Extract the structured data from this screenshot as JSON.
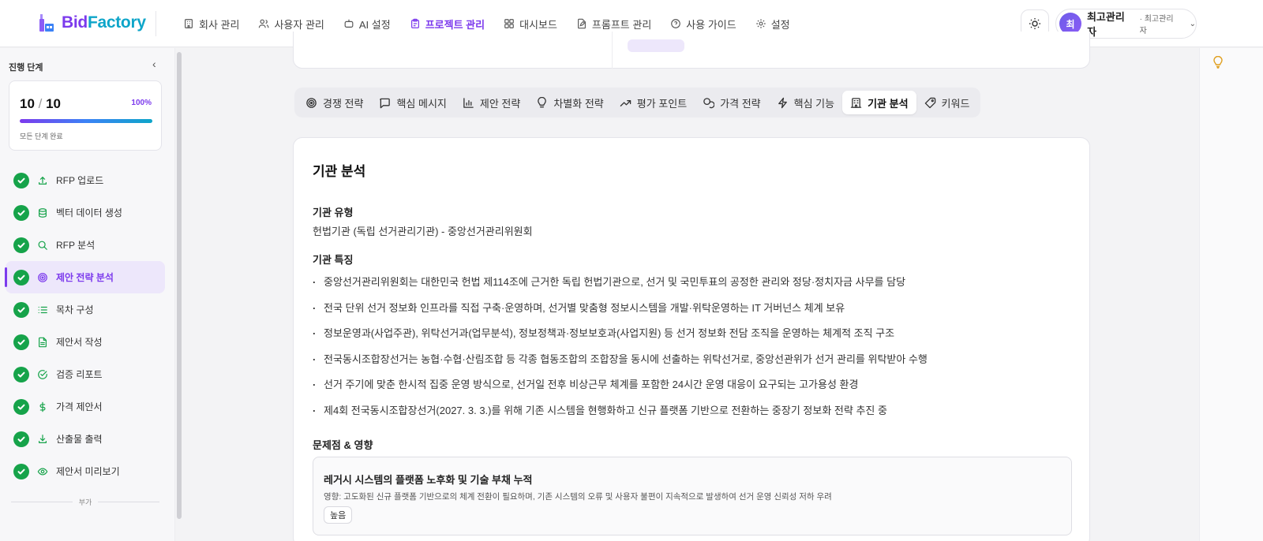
{
  "brand": {
    "name_part1": "Bid",
    "name_part2": "Factory"
  },
  "nav": [
    {
      "label": "회사 관리",
      "icon": "building-icon"
    },
    {
      "label": "사용자 관리",
      "icon": "users-icon"
    },
    {
      "label": "AI 설정",
      "icon": "bot-icon"
    },
    {
      "label": "프로젝트 관리",
      "icon": "clipboard-icon",
      "active": true
    },
    {
      "label": "대시보드",
      "icon": "grid-icon"
    },
    {
      "label": "프롬프트 관리",
      "icon": "file-edit-icon"
    },
    {
      "label": "사용 가이드",
      "icon": "help-circle-icon"
    },
    {
      "label": "설정",
      "icon": "gear-icon"
    }
  ],
  "user": {
    "initial": "최",
    "name": "최고관리자",
    "role": "· 최고관리자"
  },
  "sidebar": {
    "title": "진행 단계",
    "progress": {
      "done": "10",
      "total": "10",
      "percent": "100%",
      "value": 1.0,
      "label": "모든 단계 완료"
    },
    "steps": [
      {
        "label": "RFP 업로드",
        "icon": "upload-icon"
      },
      {
        "label": "벡터 데이터 생성",
        "icon": "database-icon"
      },
      {
        "label": "RFP 분석",
        "icon": "search-icon"
      },
      {
        "label": "제안 전략 분석",
        "icon": "target-icon",
        "active": true
      },
      {
        "label": "목차 구성",
        "icon": "list-icon"
      },
      {
        "label": "제안서 작성",
        "icon": "document-icon"
      },
      {
        "label": "검증 리포트",
        "icon": "check-circle-icon"
      },
      {
        "label": "가격 제안서",
        "icon": "dollar-icon"
      },
      {
        "label": "산출물 출력",
        "icon": "download-icon"
      },
      {
        "label": "제안서 미리보기",
        "icon": "eye-icon"
      }
    ],
    "extra_label": "부가"
  },
  "tabs": [
    {
      "label": "경쟁 전략",
      "icon": "target-icon"
    },
    {
      "label": "핵심 메시지",
      "icon": "message-icon"
    },
    {
      "label": "제안 전략",
      "icon": "bar-chart-icon"
    },
    {
      "label": "차별화 전략",
      "icon": "lightbulb-icon"
    },
    {
      "label": "평가 포인트",
      "icon": "trending-up-icon"
    },
    {
      "label": "가격 전략",
      "icon": "coins-icon"
    },
    {
      "label": "핵심 기능",
      "icon": "zap-icon"
    },
    {
      "label": "기관 분석",
      "icon": "institution-icon",
      "active": true
    },
    {
      "label": "키워드",
      "icon": "tag-icon"
    }
  ],
  "content": {
    "title": "기관 분석",
    "org_type_heading": "기관 유형",
    "org_type": "헌법기관 (독립 선거관리기관) - 중앙선거관리위원회",
    "features_heading": "기관 특징",
    "features": [
      "중앙선거관리위원회는 대한민국 헌법 제114조에 근거한 독립 헌법기관으로, 선거 및 국민투표의 공정한 관리와 정당·정치자금 사무를 담당",
      "전국 단위 선거 정보화 인프라를 직접 구축·운영하며, 선거별 맞춤형 정보시스템을 개발·위탁운영하는 IT 거버넌스 체계 보유",
      "정보운영과(사업주관), 위탁선거과(업무분석), 정보정책과·정보보호과(사업지원) 등 선거 정보화 전담 조직을 운영하는 체계적 조직 구조",
      "전국동시조합장선거는 농협·수협·산림조합 등 각종 협동조합의 조합장을 동시에 선출하는 위탁선거로, 중앙선관위가 선거 관리를 위탁받아 수행",
      "선거 주기에 맞춘 한시적 집중 운영 방식으로, 선거일 전후 비상근무 체계를 포함한 24시간 운영 대응이 요구되는 고가용성 환경",
      "제4회 전국동시조합장선거(2027. 3. 3.)를 위해 기존 시스템을 현행화하고 신규 플랫폼 기반으로 전환하는 중장기 정보화 전략 추진 중"
    ],
    "issues_heading": "문제점 & 영향",
    "issue": {
      "title": "레거시 시스템의 플랫폼 노후화 및 기술 부채 누적",
      "desc": "영향: 고도화된 신규 플랫폼 기반으로의 체계 전환이 필요하며, 기존 시스템의 오류 및 사용자 불편이 지속적으로 발생하여 선거 운영 신뢰성 저하 우려",
      "badge": "높음"
    }
  },
  "colors": {
    "accent": "#7c3aed",
    "success": "#16a34a",
    "brand_cyan": "#0ea5c9"
  }
}
